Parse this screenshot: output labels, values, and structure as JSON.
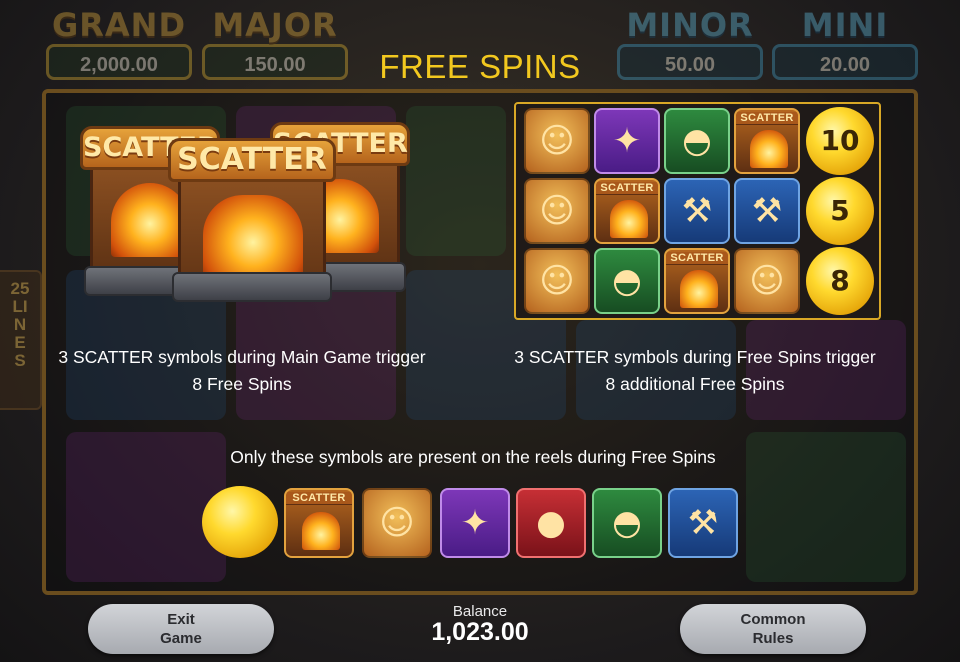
{
  "jackpots": {
    "grand": {
      "label": "GRAND",
      "value": "2,000.00"
    },
    "major": {
      "label": "MAJOR",
      "value": "150.00"
    },
    "minor": {
      "label": "MINOR",
      "value": "50.00"
    },
    "mini": {
      "label": "MINI",
      "value": "20.00"
    }
  },
  "lines_badge": "25 LINES",
  "title": "FREE SPINS",
  "scatter_label": "SCATTER",
  "demo_grid": {
    "rows": [
      [
        "miner",
        "dog",
        "pan",
        "scatter"
      ],
      [
        "miner",
        "scatter",
        "pick",
        "pick"
      ],
      [
        "miner",
        "pan",
        "scatter",
        "miner"
      ]
    ],
    "nugget_values": [
      "10",
      "5",
      "8"
    ]
  },
  "desc_left_line1": "3 SCATTER symbols during Main Game trigger",
  "desc_left_line2": "8 Free Spins",
  "desc_right_line1": "3 SCATTER symbols during Free Spins trigger",
  "desc_right_line2": "8 additional Free Spins",
  "symbols_note": "Only these symbols are present on the reels during Free Spins",
  "symbols": [
    "nugget",
    "scatter",
    "miner",
    "dog",
    "sack",
    "pan",
    "pick"
  ],
  "icons": {
    "miner": "miner-icon",
    "dog": "dog-icon",
    "pan": "gold-pan-icon",
    "pick": "pickaxe-icon",
    "scatter": "scatter-mine-icon",
    "sack": "gold-sack-icon",
    "nugget": "gold-nugget-icon"
  },
  "colors": {
    "title": "#f2c81f",
    "frame_border": "#d9a826"
  },
  "buttons": {
    "exit": "Exit\nGame",
    "rules": "Common\nRules"
  },
  "balance": {
    "label": "Balance",
    "value": "1,023.00"
  }
}
